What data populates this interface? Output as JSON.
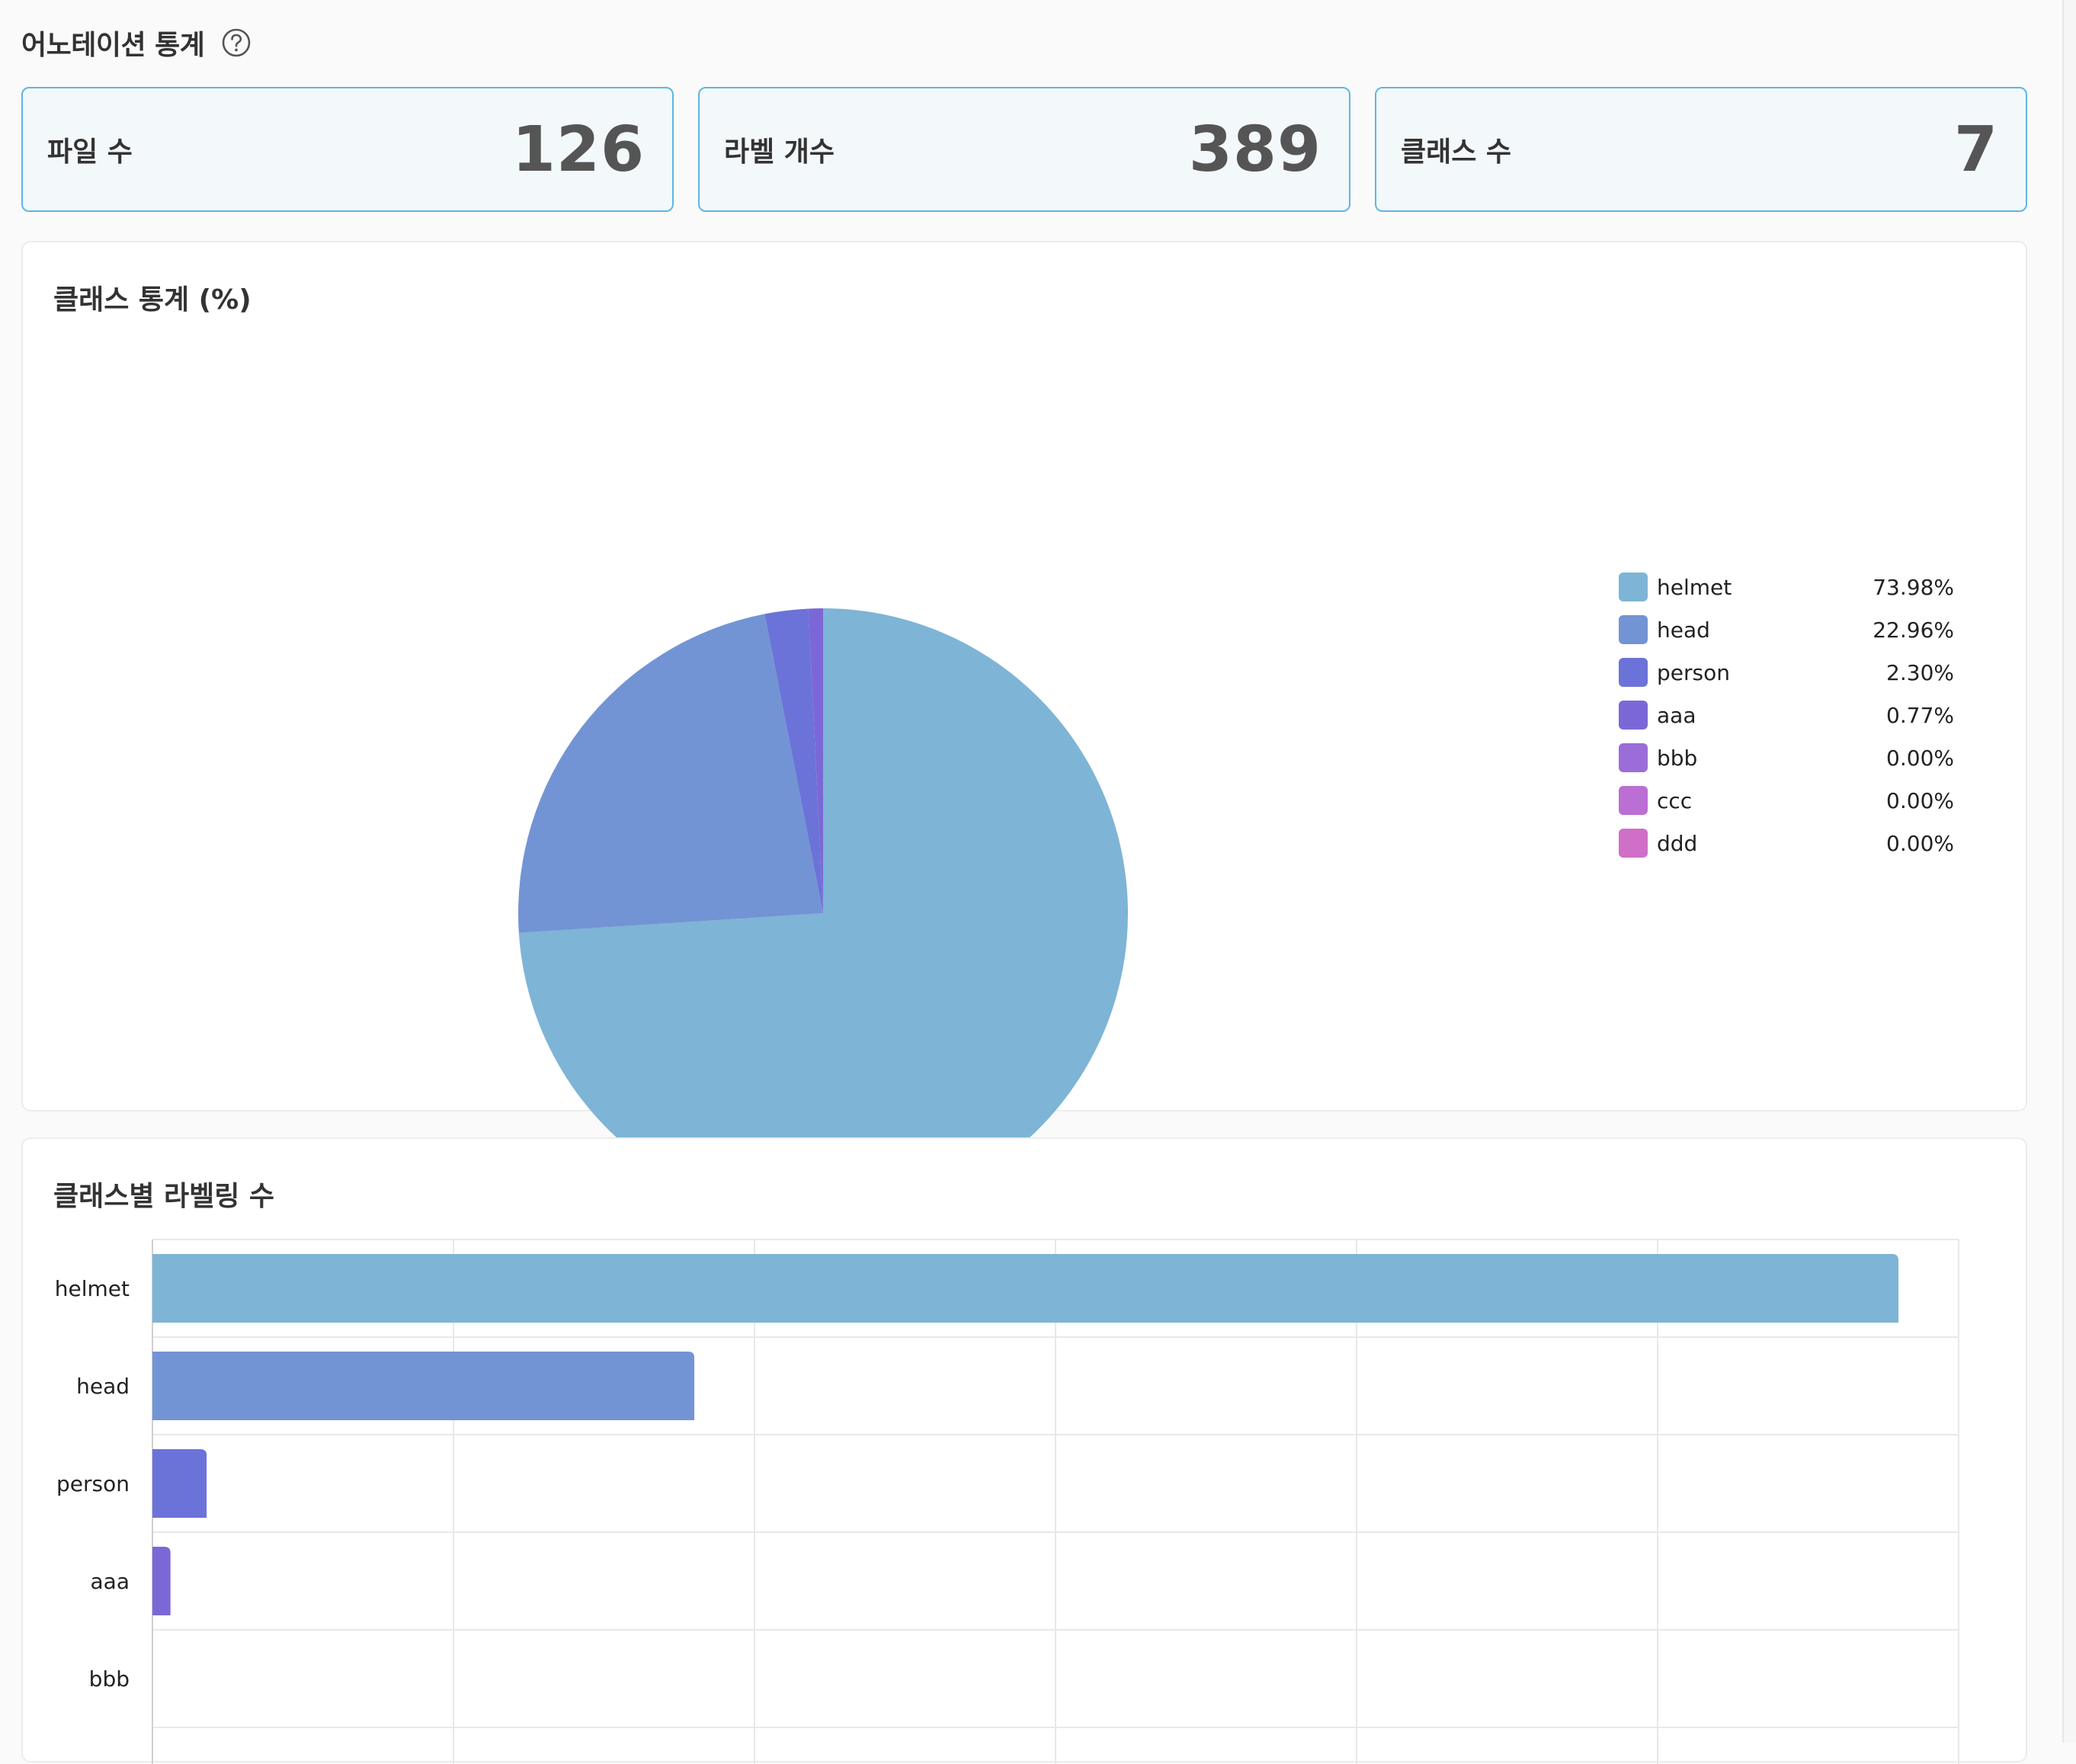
{
  "header": {
    "title": "어노테이션 통계",
    "help_icon": "question-circle-icon"
  },
  "stats": [
    {
      "label": "파일 수",
      "value": "126"
    },
    {
      "label": "라벨 개수",
      "value": "389"
    },
    {
      "label": "클래스 수",
      "value": "7"
    }
  ],
  "pie_panel": {
    "title": "클래스 통계 (%)"
  },
  "bar_panel": {
    "title": "클래스별 라벨링 수"
  },
  "legend": [
    {
      "name": "helmet",
      "value": "73.98%",
      "color": "#7eb4d6"
    },
    {
      "name": "head",
      "value": "22.96%",
      "color": "#7394d4"
    },
    {
      "name": "person",
      "value": "2.30%",
      "color": "#6b73d8"
    },
    {
      "name": "aaa",
      "value": "0.77%",
      "color": "#7b68d6"
    },
    {
      "name": "bbb",
      "value": "0.00%",
      "color": "#9b6dd8"
    },
    {
      "name": "ccc",
      "value": "0.00%",
      "color": "#bb6fd4"
    },
    {
      "name": "ddd",
      "value": "0.00%",
      "color": "#cf6fc8"
    }
  ],
  "chart_data": [
    {
      "type": "pie",
      "title": "클래스 통계 (%)",
      "categories": [
        "helmet",
        "head",
        "person",
        "aaa",
        "bbb",
        "ccc",
        "ddd"
      ],
      "values": [
        73.98,
        22.96,
        2.3,
        0.77,
        0.0,
        0.0,
        0.0
      ],
      "colors": [
        "#7eb4d6",
        "#7394d4",
        "#6b73d8",
        "#7b68d6",
        "#9b6dd8",
        "#bb6fd4",
        "#cf6fc8"
      ],
      "legend": "right"
    },
    {
      "type": "bar",
      "orientation": "horizontal",
      "title": "클래스별 라벨링 수",
      "categories": [
        "helmet",
        "head",
        "person",
        "aaa",
        "bbb"
      ],
      "values": [
        290,
        90,
        9,
        3,
        0
      ],
      "colors": [
        "#7eb4d6",
        "#7394d4",
        "#6b73d8",
        "#7b68d6",
        "#9b6dd8"
      ],
      "xlim": [
        0,
        300
      ],
      "grid": true
    }
  ]
}
